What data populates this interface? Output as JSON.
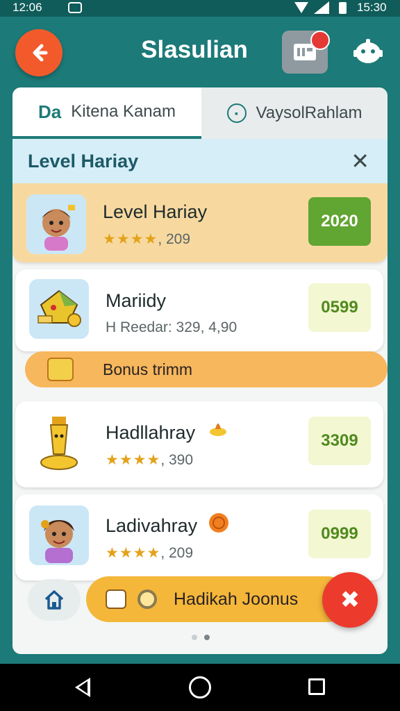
{
  "status_bar": {
    "time_left": "12:06",
    "time_right": "15:30"
  },
  "app_bar": {
    "title": "Slasulian",
    "back_icon": "arrow-left-icon",
    "news_icon": "newspaper-icon",
    "bot_icon": "bot-face-icon"
  },
  "tabs": [
    {
      "icon_text": "Da",
      "label": "Kitena Kanam",
      "selected": true
    },
    {
      "label": "VaysolRahlam",
      "selected": false
    }
  ],
  "level_header": {
    "title": "Level Hariay",
    "close_icon": "close-icon"
  },
  "rows": [
    {
      "name": "Level Hariay",
      "stars": "★★★★",
      "sub": ", 209",
      "score": "2020",
      "highlighted": true
    },
    {
      "name": "Mariidy",
      "sub": "H Reedar: 329, 4,90",
      "score": "0599"
    },
    {
      "name": "Hadllahray",
      "stars": "★★★★",
      "sub": ", 390",
      "score": "3309"
    },
    {
      "name": "Ladivahray",
      "stars": "★★★★",
      "sub": ", 209",
      "score": "0999"
    }
  ],
  "bonus": {
    "label": "Bonus trimm"
  },
  "footer": {
    "home_icon": "home-icon",
    "button_label": "Hadikah Joonus",
    "fab_icon": "close-x-icon"
  },
  "nav": {
    "back": "back-icon",
    "home": "home-circle-icon",
    "recents": "recents-icon"
  },
  "colors": {
    "teal": "#1c7a78",
    "orange": "#f25a2b",
    "score_green": "#61a532",
    "highlight": "#f7d9a0",
    "bonus": "#f6b75d"
  }
}
